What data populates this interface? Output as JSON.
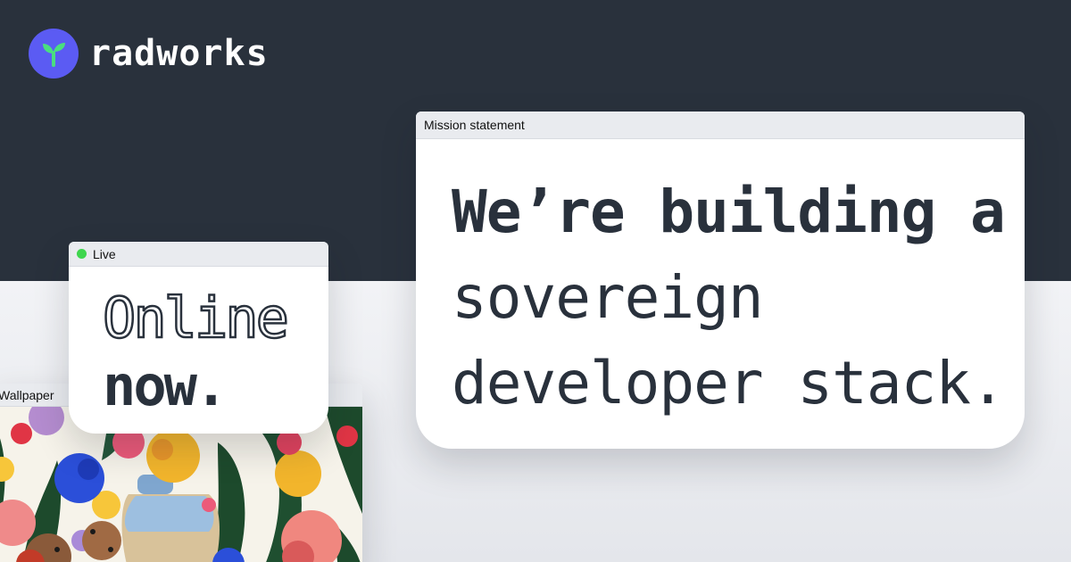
{
  "brand": {
    "name": "radworks",
    "logo_icon": "sprout-icon",
    "accent_color": "#5b5bf3"
  },
  "windows": {
    "mission": {
      "title": "Mission statement",
      "lines": [
        "We’re building a",
        "sovereign",
        "developer stack."
      ]
    },
    "live": {
      "title": "Live",
      "status_color": "#3fd64e",
      "line1": "Online",
      "line2": "now."
    },
    "wallpaper": {
      "title": "Wallpaper",
      "image": "flower-illustration"
    }
  },
  "colors": {
    "dark_band": "#29313c",
    "text": "#29313c"
  }
}
